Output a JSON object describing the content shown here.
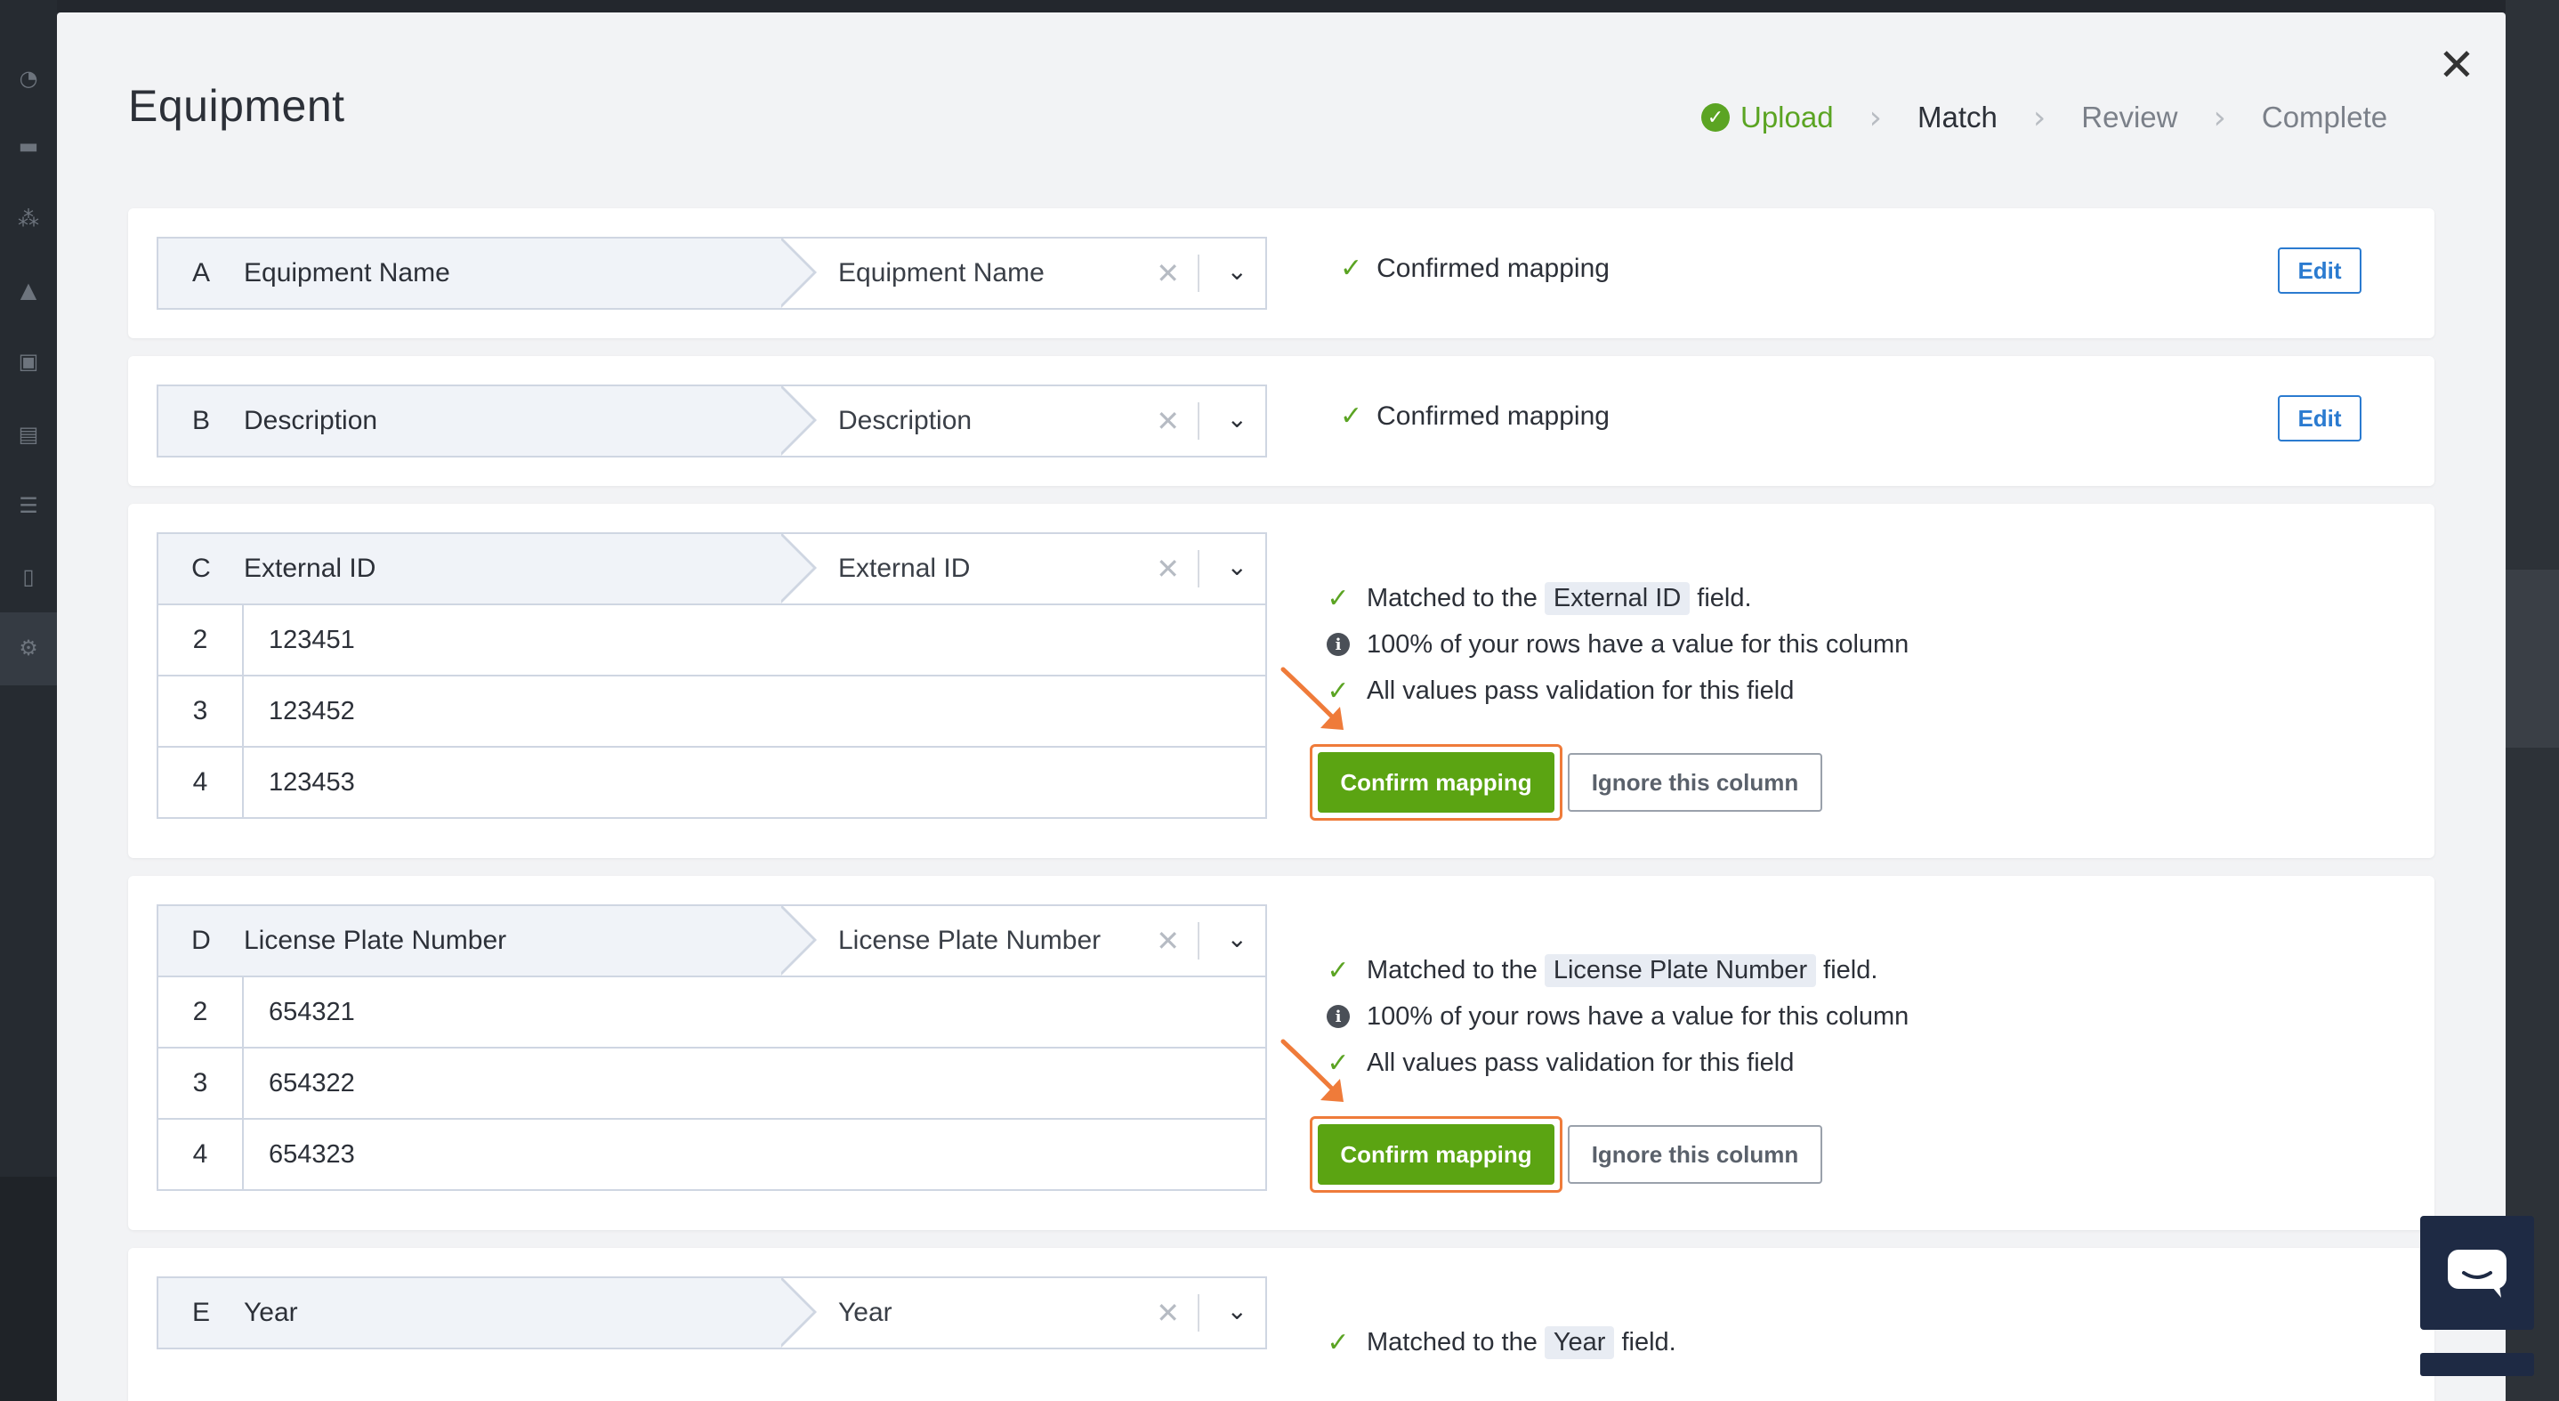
{
  "modal": {
    "title": "Equipment",
    "close_icon": "close-icon",
    "steps": [
      {
        "label": "Upload",
        "state": "done"
      },
      {
        "label": "Match",
        "state": "current"
      },
      {
        "label": "Review",
        "state": "pending"
      },
      {
        "label": "Complete",
        "state": "pending"
      }
    ]
  },
  "columns": [
    {
      "letter": "A",
      "source": "Equipment Name",
      "target": "Equipment Name",
      "status": "Confirmed mapping",
      "edit_label": "Edit"
    },
    {
      "letter": "B",
      "source": "Description",
      "target": "Description",
      "status": "Confirmed mapping",
      "edit_label": "Edit"
    },
    {
      "letter": "C",
      "source": "External ID",
      "target": "External ID",
      "rows": [
        {
          "n": "2",
          "v": "123451"
        },
        {
          "n": "3",
          "v": "123452"
        },
        {
          "n": "4",
          "v": "123453"
        }
      ],
      "matched_prefix": "Matched to the",
      "matched_field": "External ID",
      "matched_suffix": "field.",
      "rows_info": "100% of your rows have a value for this column",
      "validation": "All values pass validation for this field",
      "confirm_label": "Confirm mapping",
      "ignore_label": "Ignore this column"
    },
    {
      "letter": "D",
      "source": "License Plate Number",
      "target": "License Plate Number",
      "rows": [
        {
          "n": "2",
          "v": "654321"
        },
        {
          "n": "3",
          "v": "654322"
        },
        {
          "n": "4",
          "v": "654323"
        }
      ],
      "matched_prefix": "Matched to the",
      "matched_field": "License Plate Number",
      "matched_suffix": "field.",
      "rows_info": "100% of your rows have a value for this column",
      "validation": "All values pass validation for this field",
      "confirm_label": "Confirm mapping",
      "ignore_label": "Ignore this column"
    },
    {
      "letter": "E",
      "source": "Year",
      "target": "Year",
      "matched_prefix": "Matched to the",
      "matched_field": "Year",
      "matched_suffix": "field."
    }
  ],
  "colors": {
    "accent_green": "#5ba412",
    "link_blue": "#2b7bd0",
    "annotation_orange": "#ef7b3a"
  }
}
